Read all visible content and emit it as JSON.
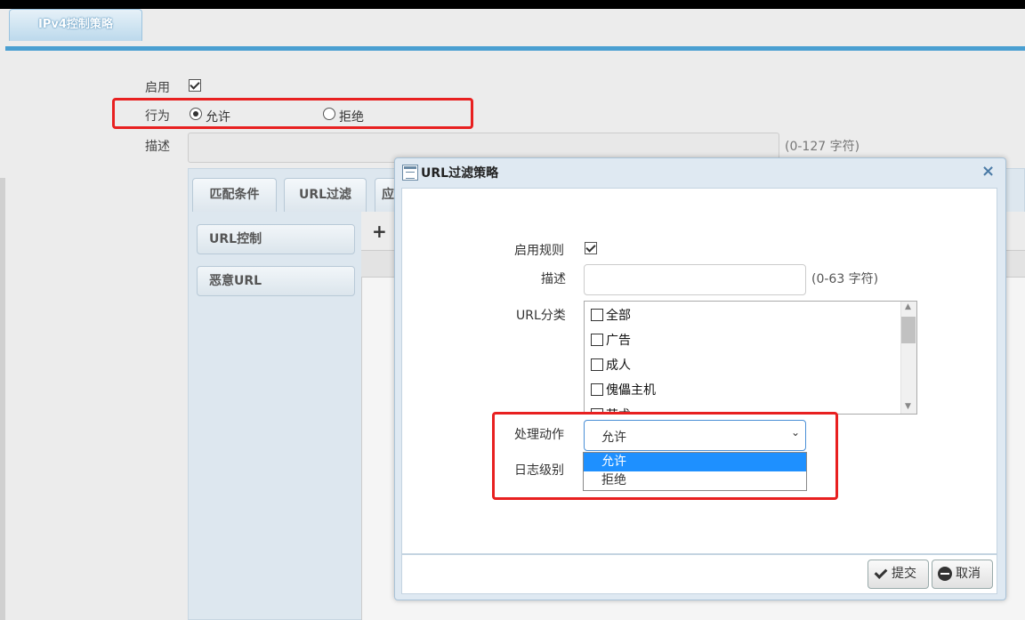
{
  "page_tab": {
    "label": "IPv4控制策略"
  },
  "main_form": {
    "enable_label": "启用",
    "enable_checked": true,
    "action_label": "行为",
    "action_options": [
      "允许",
      "拒绝"
    ],
    "action_selected": "允许",
    "desc_label": "描述",
    "desc_value": "",
    "desc_hint": "(0-127 字符)"
  },
  "sub_tabs": [
    "匹配条件",
    "URL过滤",
    "应"
  ],
  "side_menu": [
    "URL控制",
    "恶意URL"
  ],
  "dialog": {
    "title": "URL过滤策略",
    "close_symbol": "×",
    "enable_rule_label": "启用规则",
    "enable_rule_checked": true,
    "desc_label": "描述",
    "desc_value": "",
    "desc_hint": "(0-63 字符)",
    "url_category_label": "URL分类",
    "url_categories": [
      "全部",
      "广告",
      "成人",
      "傀儡主机",
      "艺术"
    ],
    "action_label": "处理动作",
    "action_value": "允许",
    "action_options": [
      "允许",
      "拒绝"
    ],
    "log_level_label": "日志级别",
    "submit_label": "提交",
    "cancel_label": "取消"
  },
  "colors": {
    "accent": "#4a9fd1",
    "highlight_border": "#e82020",
    "selected_option": "#1e90ff"
  }
}
